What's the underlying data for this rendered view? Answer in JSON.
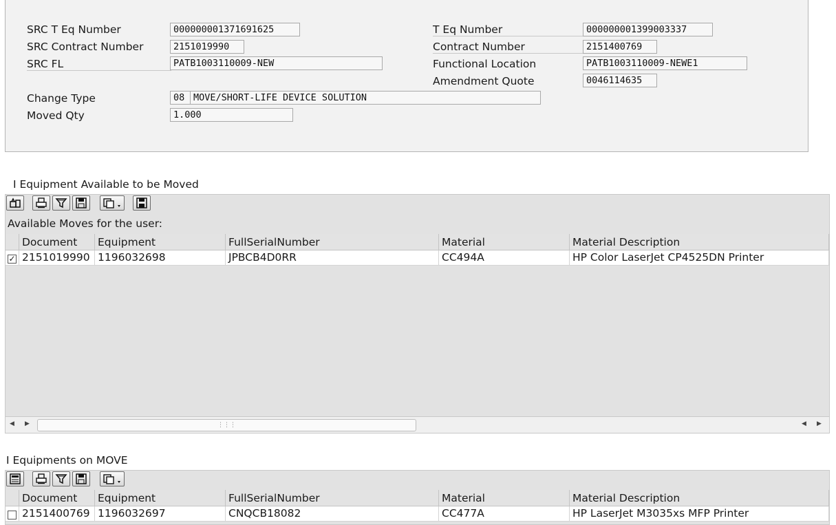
{
  "header_form": {
    "src_t_eq_number": {
      "label": "SRC T Eq Number",
      "value": "000000001371691625"
    },
    "src_contract_number": {
      "label": "SRC Contract Number",
      "value": "2151019990"
    },
    "src_fl": {
      "label": "SRC FL",
      "value": "PATB1003110009-NEW"
    },
    "change_type": {
      "label": "Change Type",
      "code": "08",
      "value": "MOVE/SHORT-LIFE DEVICE SOLUTION"
    },
    "moved_qty": {
      "label": "Moved Qty",
      "value": "1.000"
    },
    "t_eq_number": {
      "label": "T Eq Number",
      "value": "000000001399003337"
    },
    "contract_number": {
      "label": "Contract Number",
      "value": "2151400769"
    },
    "functional_location": {
      "label": "Functional Location",
      "value": "PATB1003110009-NEWE1"
    },
    "amendment_quote": {
      "label": "Amendment Quote",
      "value": "0046114635"
    }
  },
  "available_section": {
    "title": "I Equipment Available to be Moved",
    "grid_title": "Available Moves for the user:",
    "columns": [
      "Document",
      "Equipment",
      "FullSerialNumber",
      "Material",
      "Material Description"
    ],
    "rows": [
      {
        "checked": true,
        "document": "2151019990",
        "equipment": "1196032698",
        "serial": "JPBCB4D0RR",
        "material": "CC494A",
        "description": "HP Color LaserJet CP4525DN Printer"
      }
    ]
  },
  "move_section": {
    "title": "I Equipments on MOVE",
    "columns": [
      "Document",
      "Equipment",
      "FullSerialNumber",
      "Material",
      "Material Description"
    ],
    "rows": [
      {
        "checked": false,
        "document": "2151400769",
        "equipment": "1196032697",
        "serial": "CNQCB18082",
        "material": "CC477A",
        "description": "HP LaserJet M3035xs MFP Printer"
      }
    ]
  },
  "icons": [
    "details-icon",
    "print-icon",
    "filter-icon",
    "save-layout-icon",
    "export-icon",
    "save-icon",
    "select-layout-icon",
    "scroll-left-icon",
    "scroll-right-icon"
  ]
}
